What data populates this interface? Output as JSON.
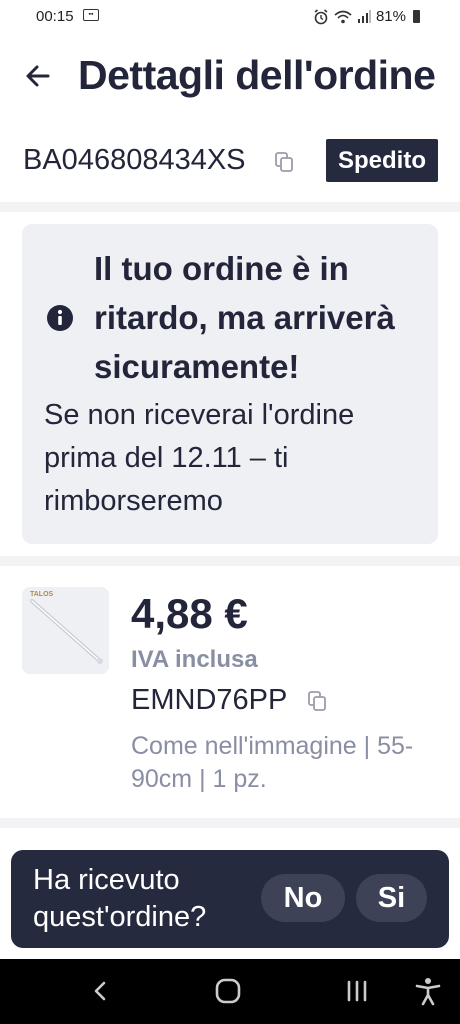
{
  "status_bar": {
    "time": "00:15",
    "battery": "81%"
  },
  "header": {
    "title": "Dettagli dell'ordine"
  },
  "order": {
    "id": "BA046808434XS",
    "status": "Spedito"
  },
  "alert": {
    "title": "Il tuo ordine è in ritardo, ma arriverà sicuramente!",
    "body": "Se non riceverai l'ordine prima del 12.11 – ti rimborseremo"
  },
  "product": {
    "thumb_brand": "TALOS",
    "price": "4,88 €",
    "vat": "IVA inclusa",
    "code": "EMND76PP",
    "variant": "Come nell'immagine | 55-90cm | 1 pz."
  },
  "confirm": {
    "question": "Ha ricevuto quest'ordine?",
    "no_label": "No",
    "yes_label": "Si"
  },
  "icons": {
    "back": "arrow-left-icon",
    "copy": "copy-icon",
    "info": "info-icon",
    "nav_back": "chevron-left-icon",
    "nav_home": "home-icon",
    "nav_recents": "recents-icon",
    "nav_accessibility": "accessibility-icon"
  },
  "colors": {
    "dark": "#262a3e",
    "muted": "#8a8ea3",
    "card": "#eff0f4"
  }
}
